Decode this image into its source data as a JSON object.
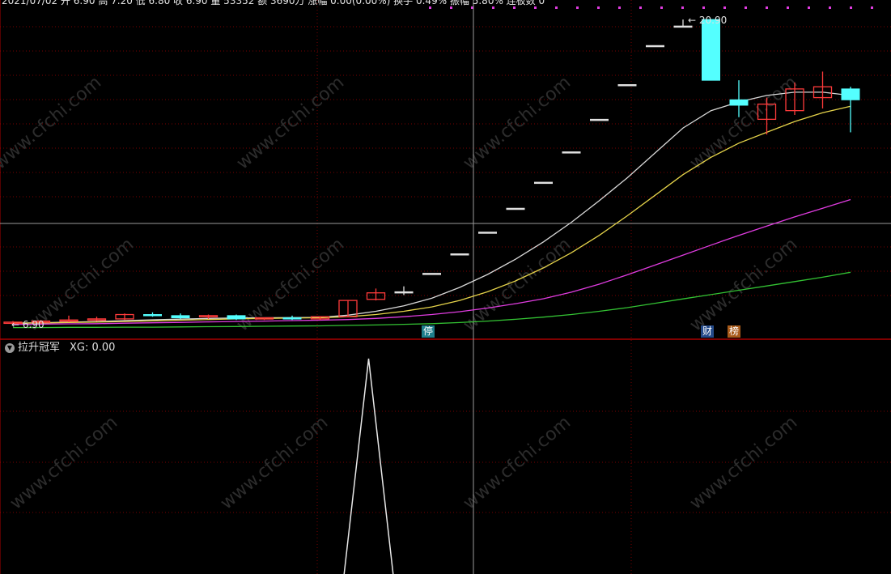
{
  "header": {
    "text": "2021/07/02 开 6.90 高 7.20 低 6.80 收 6.90 量 53352 额 3690万 涨幅 0.00(0.00%) 换手 0.49% 振幅 5.80% 连板数 0"
  },
  "watermark": {
    "text": "www.cfchi.com"
  },
  "badges": {
    "stop": "停",
    "finance": "财",
    "rank": "榜"
  },
  "indicator": {
    "name": "拉升冠军",
    "xg_label": "XG: 0.00"
  },
  "colors": {
    "background": "#000000",
    "up_candle": "#ff3b3b",
    "down_candle": "#54ffff",
    "ma_white": "#d8d8d8",
    "ma_yellow": "#e5d34a",
    "ma_magenta": "#e03ce0",
    "ma_green": "#33c233",
    "grid_red": "#7a0000",
    "panel_border": "#aa0000",
    "indicator_line": "#e8e8e8"
  },
  "chart_data": [
    {
      "type": "candlestick",
      "price_labels": {
        "high": "20.90",
        "low": "6.90"
      },
      "ylim": [
        6.2,
        21.8
      ],
      "candles": [
        {
          "o": 6.9,
          "h": 7.0,
          "l": 6.82,
          "c": 6.95
        },
        {
          "o": 6.95,
          "h": 7.05,
          "l": 6.88,
          "c": 7.0
        },
        {
          "o": 7.0,
          "h": 7.25,
          "l": 6.95,
          "c": 7.05
        },
        {
          "o": 7.05,
          "h": 7.2,
          "l": 7.0,
          "c": 7.1
        },
        {
          "o": 7.1,
          "h": 7.35,
          "l": 7.05,
          "c": 7.3
        },
        {
          "o": 7.3,
          "h": 7.4,
          "l": 7.2,
          "c": 7.25
        },
        {
          "o": 7.25,
          "h": 7.35,
          "l": 7.1,
          "c": 7.15
        },
        {
          "o": 7.2,
          "h": 7.3,
          "l": 7.1,
          "c": 7.25
        },
        {
          "o": 7.25,
          "h": 7.3,
          "l": 7.05,
          "c": 7.1
        },
        {
          "o": 7.1,
          "h": 7.15,
          "l": 7.05,
          "c": 7.15
        },
        {
          "o": 7.15,
          "h": 7.25,
          "l": 7.05,
          "c": 7.1
        },
        {
          "o": 7.1,
          "h": 7.2,
          "l": 7.05,
          "c": 7.2
        },
        {
          "o": 7.2,
          "h": 7.95,
          "l": 7.2,
          "c": 7.95
        },
        {
          "o": 8.0,
          "h": 8.5,
          "l": 7.95,
          "c": 8.3
        },
        {
          "o": 8.35,
          "h": 8.6,
          "l": 8.2,
          "c": 8.35
        },
        {
          "o": 9.2,
          "h": 9.2,
          "l": 9.2,
          "c": 9.2
        },
        {
          "o": 10.1,
          "h": 10.1,
          "l": 10.1,
          "c": 10.1
        },
        {
          "o": 11.1,
          "h": 11.1,
          "l": 11.1,
          "c": 11.1
        },
        {
          "o": 12.2,
          "h": 12.2,
          "l": 12.2,
          "c": 12.2
        },
        {
          "o": 13.4,
          "h": 13.4,
          "l": 13.4,
          "c": 13.4
        },
        {
          "o": 14.8,
          "h": 14.8,
          "l": 14.8,
          "c": 14.8
        },
        {
          "o": 16.3,
          "h": 16.3,
          "l": 16.3,
          "c": 16.3
        },
        {
          "o": 17.9,
          "h": 17.9,
          "l": 17.9,
          "c": 17.9
        },
        {
          "o": 19.7,
          "h": 19.7,
          "l": 19.7,
          "c": 19.7
        },
        {
          "o": 20.6,
          "h": 20.9,
          "l": 20.6,
          "c": 20.6
        },
        {
          "o": 20.9,
          "h": 20.9,
          "l": 18.1,
          "c": 18.1
        },
        {
          "o": 17.2,
          "h": 18.1,
          "l": 16.4,
          "c": 16.95
        },
        {
          "o": 16.3,
          "h": 17.3,
          "l": 15.6,
          "c": 17.0
        },
        {
          "o": 16.7,
          "h": 18.0,
          "l": 16.5,
          "c": 17.7
        },
        {
          "o": 17.3,
          "h": 18.5,
          "l": 16.8,
          "c": 17.8
        },
        {
          "o": 17.7,
          "h": 17.8,
          "l": 15.7,
          "c": 17.2
        }
      ],
      "ma_series": [
        {
          "color": "#d8d8d8",
          "values": [
            6.9,
            6.92,
            6.95,
            6.98,
            7.02,
            7.06,
            7.09,
            7.12,
            7.14,
            7.15,
            7.16,
            7.17,
            7.27,
            7.45,
            7.7,
            8.05,
            8.55,
            9.15,
            9.85,
            10.65,
            11.55,
            12.55,
            13.6,
            14.75,
            15.9,
            16.7,
            17.1,
            17.4,
            17.55,
            17.55,
            17.4
          ]
        },
        {
          "color": "#e5d34a",
          "values": [
            6.9,
            6.91,
            6.93,
            6.95,
            6.98,
            7.01,
            7.04,
            7.07,
            7.1,
            7.12,
            7.14,
            7.15,
            7.2,
            7.3,
            7.45,
            7.65,
            7.95,
            8.35,
            8.85,
            9.45,
            10.15,
            10.95,
            11.85,
            12.8,
            13.75,
            14.55,
            15.2,
            15.7,
            16.2,
            16.6,
            16.9
          ]
        },
        {
          "color": "#e03ce0",
          "values": [
            6.85,
            6.86,
            6.87,
            6.88,
            6.9,
            6.92,
            6.94,
            6.96,
            6.98,
            7.0,
            7.02,
            7.04,
            7.07,
            7.12,
            7.2,
            7.3,
            7.43,
            7.6,
            7.8,
            8.03,
            8.33,
            8.7,
            9.13,
            9.58,
            10.04,
            10.5,
            10.95,
            11.38,
            11.8,
            12.2,
            12.6
          ]
        },
        {
          "color": "#33c233",
          "values": [
            6.7,
            6.7,
            6.71,
            6.71,
            6.72,
            6.72,
            6.73,
            6.74,
            6.75,
            6.76,
            6.77,
            6.78,
            6.8,
            6.82,
            6.85,
            6.88,
            6.93,
            7.0,
            7.08,
            7.18,
            7.3,
            7.45,
            7.62,
            7.82,
            8.02,
            8.22,
            8.42,
            8.62,
            8.82,
            9.02,
            9.25
          ]
        }
      ]
    },
    {
      "type": "line",
      "name": "拉升冠军 XG",
      "ylim": [
        0,
        1
      ],
      "x": [
        0,
        12,
        13,
        14
      ],
      "values": [
        0,
        0,
        1,
        0
      ]
    }
  ]
}
